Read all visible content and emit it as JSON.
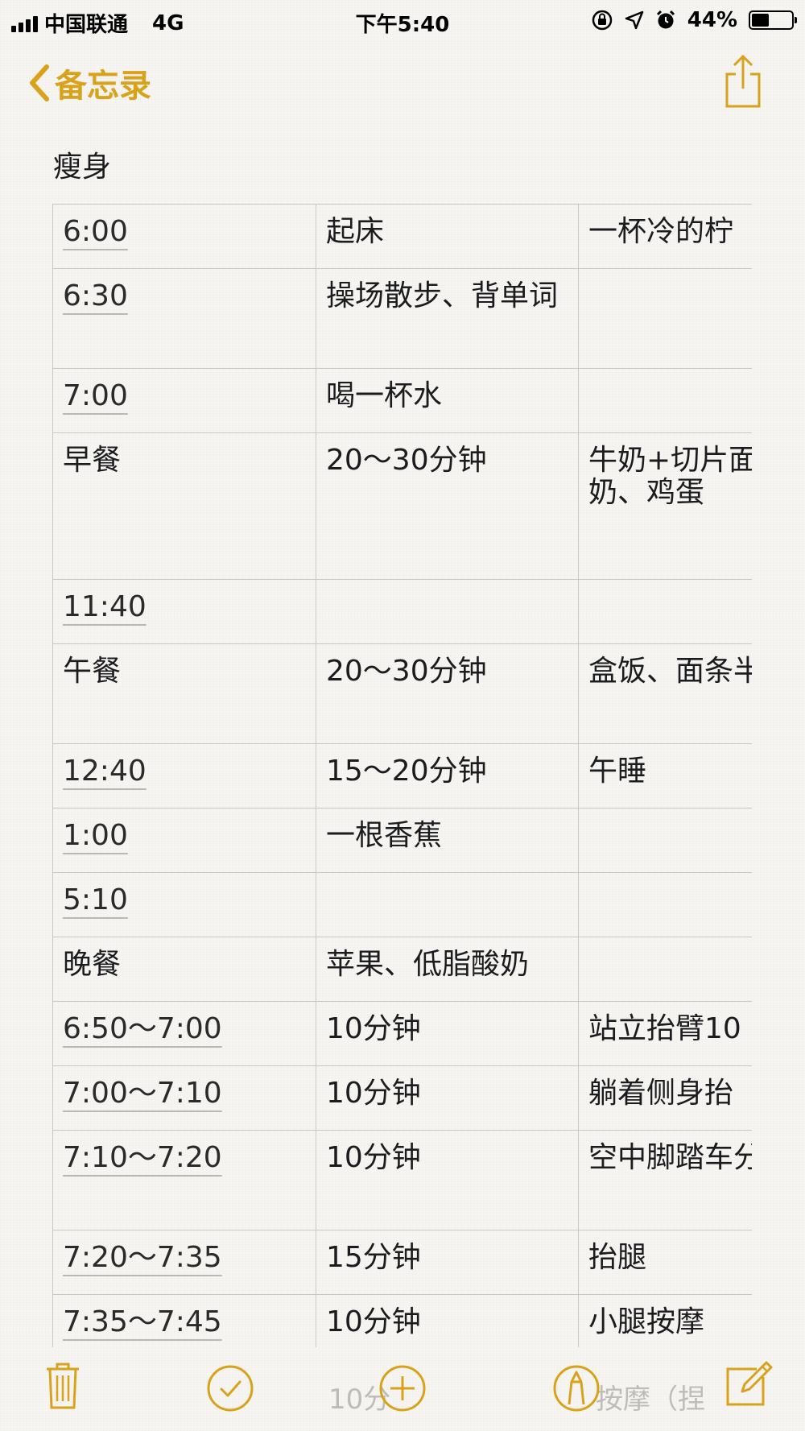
{
  "status_bar": {
    "carrier": "中国联通",
    "network": "4G",
    "time": "下午5:40",
    "battery_percent": "44%",
    "battery_level": 0.44
  },
  "nav": {
    "back_label": "备忘录"
  },
  "note": {
    "title": "瘦身"
  },
  "table": {
    "rows": [
      {
        "c0": "6:00",
        "c1": "起床",
        "c2": "一杯冷的柠",
        "time": true,
        "h": 80
      },
      {
        "c0": "6:30",
        "c1": "操场散步、背单词",
        "c2": "",
        "time": true,
        "h": 124
      },
      {
        "c0": "7:00",
        "c1": "喝一杯水",
        "c2": "",
        "time": true,
        "h": 80
      },
      {
        "c0": "早餐",
        "c1": "20～30分钟",
        "c2": "牛奶+切片面水果、全麦奶、鸡蛋",
        "time": false,
        "h": 182
      },
      {
        "c0": "11:40",
        "c1": "",
        "c2": "",
        "time": true,
        "h": 80
      },
      {
        "c0": "午餐",
        "c1": "20～30分钟",
        "c2": "盒饭、面条半",
        "time": false,
        "h": 124
      },
      {
        "c0": "12:40",
        "c1": "15～20分钟",
        "c2": "午睡",
        "time": true,
        "h": 80
      },
      {
        "c0": "1:00",
        "c1": "一根香蕉",
        "c2": "",
        "time": true,
        "h": 80
      },
      {
        "c0": "5:10",
        "c1": "",
        "c2": "",
        "time": true,
        "h": 80
      },
      {
        "c0": "晚餐",
        "c1": "苹果、低脂酸奶",
        "c2": "",
        "time": false,
        "h": 80
      },
      {
        "c0": "6:50～7:00",
        "c1": "10分钟",
        "c2": "站立抬臂10",
        "time": true,
        "h": 80
      },
      {
        "c0": "7:00～7:10",
        "c1": "10分钟",
        "c2": "躺着侧身抬",
        "time": true,
        "h": 80
      },
      {
        "c0": "7:10～7:20",
        "c1": "10分钟",
        "c2": "空中脚踏车分钟",
        "time": true,
        "h": 124
      },
      {
        "c0": "7:20～7:35",
        "c1": "15分钟",
        "c2": "抬腿",
        "time": true,
        "h": 80
      },
      {
        "c0": "7:35～7:45",
        "c1": "10分钟",
        "c2": "小腿按摩",
        "time": true,
        "h": 80
      }
    ]
  },
  "toolbar": {
    "ghost_left": "10分",
    "ghost_right": "按摩（捏"
  },
  "colors": {
    "accent": "#d9a21b",
    "border": "#c8c7c3",
    "background": "#f6f5f2"
  },
  "icons": [
    "signal-icon",
    "orientation-lock-icon",
    "location-icon",
    "alarm-icon",
    "battery-icon",
    "chevron-left-icon",
    "share-icon",
    "trash-icon",
    "checkmark-icon",
    "add-icon",
    "markup-icon",
    "compose-icon"
  ]
}
